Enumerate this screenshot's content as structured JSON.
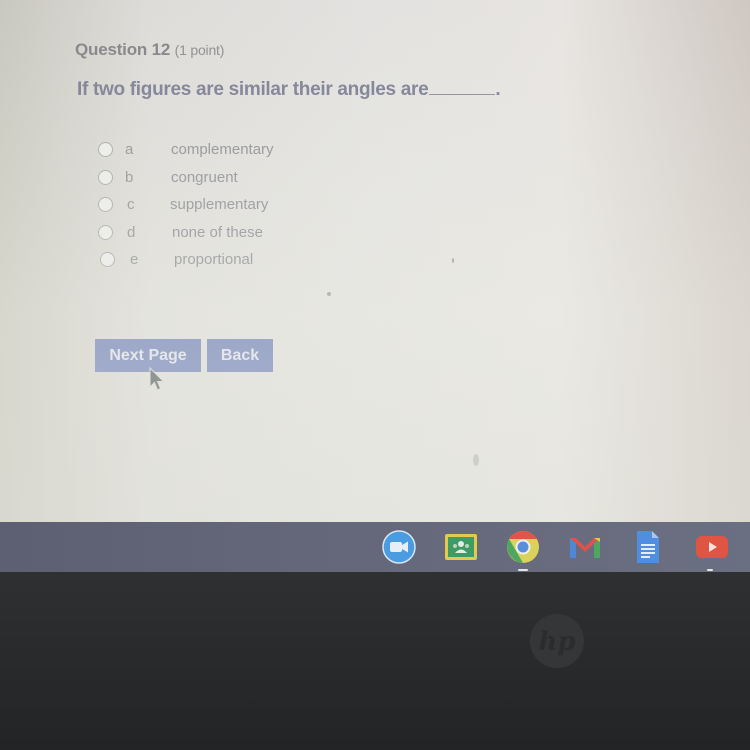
{
  "question": {
    "title": "Question 12",
    "points": "(1 point)",
    "prompt": "If two figures are similar their angles are",
    "prompt_end": "."
  },
  "options": [
    {
      "letter": "a",
      "text": "complementary",
      "selected": false
    },
    {
      "letter": "b",
      "text": "congruent",
      "selected": false
    },
    {
      "letter": "c",
      "text": "supplementary",
      "selected": false
    },
    {
      "letter": "d",
      "text": "none of these",
      "selected": false
    },
    {
      "letter": "e",
      "text": "proportional",
      "selected": false
    }
  ],
  "buttons": {
    "next_label": "Next Page",
    "back_label": "Back"
  },
  "shelf": {
    "apps": [
      {
        "name": "Zoom",
        "icon": "zoom-icon"
      },
      {
        "name": "Google Classroom",
        "icon": "classroom-icon"
      },
      {
        "name": "Google Chrome",
        "icon": "chrome-icon",
        "running": true
      },
      {
        "name": "Gmail",
        "icon": "gmail-icon"
      },
      {
        "name": "Google Docs",
        "icon": "docs-icon"
      },
      {
        "name": "YouTube",
        "icon": "youtube-icon",
        "running": true
      }
    ]
  },
  "colors": {
    "button_bg": "#6f7fb8",
    "question_text": "#7a7c92",
    "shelf_bg": "#646779",
    "bezel": "#2a2b2d"
  }
}
